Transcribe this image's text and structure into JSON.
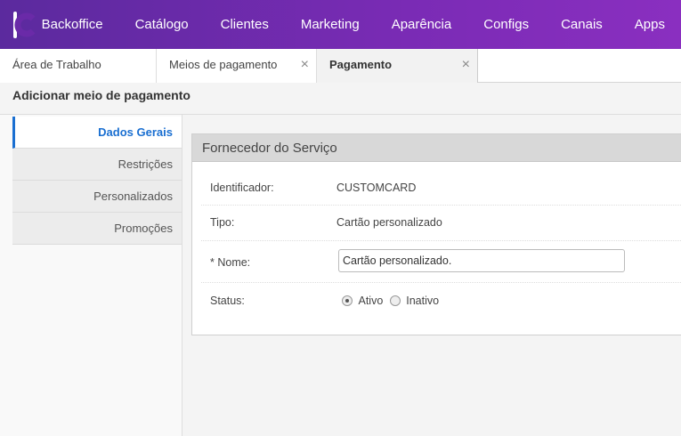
{
  "nav": {
    "logo_icon": "brand-logo-icon",
    "items": [
      "Backoffice",
      "Catálogo",
      "Clientes",
      "Marketing",
      "Aparência",
      "Configs",
      "Canais",
      "Apps"
    ]
  },
  "tabs": [
    {
      "label": "Área de Trabalho",
      "closable": false
    },
    {
      "label": "Meios de pagamento",
      "closable": true,
      "close_glyph": "×"
    },
    {
      "label": "Pagamento",
      "closable": true,
      "close_glyph": "×",
      "active": true
    }
  ],
  "page": {
    "title": "Adicionar meio de pagamento"
  },
  "sidebar": {
    "items": [
      {
        "label": "Dados Gerais",
        "active": true
      },
      {
        "label": "Restrições"
      },
      {
        "label": "Personalizados"
      },
      {
        "label": "Promoções"
      }
    ]
  },
  "section": {
    "title": "Fornecedor do Serviço",
    "identificador_label": "Identificador:",
    "identificador_value": "CUSTOMCARD",
    "tipo_label": "Tipo:",
    "tipo_value": "Cartão personalizado",
    "nome_label": "* Nome:",
    "nome_value": "Cartão personalizado.",
    "status_label": "Status:",
    "status_options": [
      {
        "label": "Ativo",
        "selected": true
      },
      {
        "label": "Inativo",
        "selected": false
      }
    ]
  },
  "colors": {
    "nav_start": "#5b2a9e",
    "nav_end": "#8a2fc0",
    "accent": "#1a6fd1"
  }
}
